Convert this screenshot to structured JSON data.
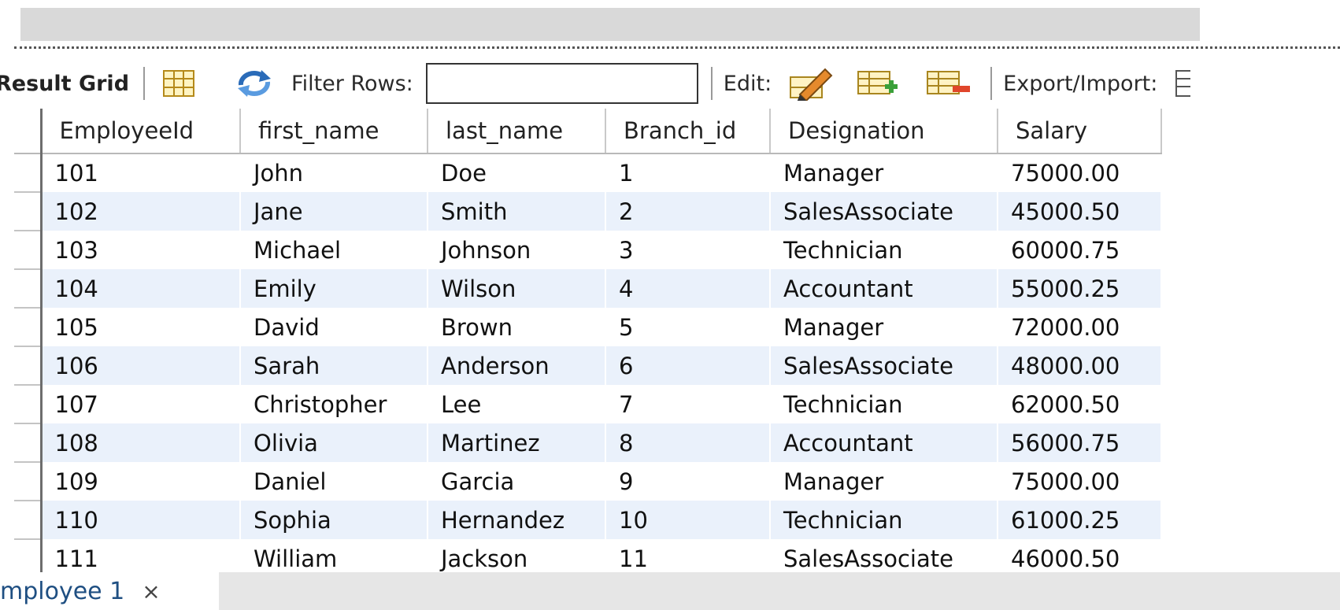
{
  "toolbar": {
    "result_grid_label": "Result Grid",
    "filter_rows_label": "Filter Rows:",
    "filter_value": "",
    "edit_label": "Edit:",
    "export_import_label": "Export/Import:",
    "icons": [
      "grid-layout-icon",
      "refresh-icon",
      "edit-pencil-icon",
      "add-row-icon",
      "delete-row-icon",
      "export-icon"
    ]
  },
  "grid": {
    "columns": [
      "EmployeeId",
      "first_name",
      "last_name",
      "Branch_id",
      "Designation",
      "Salary"
    ],
    "rows": [
      [
        "101",
        "John",
        "Doe",
        "1",
        "Manager",
        "75000.00"
      ],
      [
        "102",
        "Jane",
        "Smith",
        "2",
        "SalesAssociate",
        "45000.50"
      ],
      [
        "103",
        "Michael",
        "Johnson",
        "3",
        "Technician",
        "60000.75"
      ],
      [
        "104",
        "Emily",
        "Wilson",
        "4",
        "Accountant",
        "55000.25"
      ],
      [
        "105",
        "David",
        "Brown",
        "5",
        "Manager",
        "72000.00"
      ],
      [
        "106",
        "Sarah",
        "Anderson",
        "6",
        "SalesAssociate",
        "48000.00"
      ],
      [
        "107",
        "Christopher",
        "Lee",
        "7",
        "Technician",
        "62000.50"
      ],
      [
        "108",
        "Olivia",
        "Martinez",
        "8",
        "Accountant",
        "56000.75"
      ],
      [
        "109",
        "Daniel",
        "Garcia",
        "9",
        "Manager",
        "75000.00"
      ],
      [
        "110",
        "Sophia",
        "Hernandez",
        "10",
        "Technician",
        "61000.25"
      ],
      [
        "111",
        "William",
        "Jackson",
        "11",
        "SalesAssociate",
        "46000.50"
      ]
    ]
  },
  "tabs": [
    {
      "label": "mployee 1",
      "close": "×"
    }
  ],
  "colors": {
    "row_stripe": "#eaf1fb",
    "tab_text": "#1f4f82"
  }
}
